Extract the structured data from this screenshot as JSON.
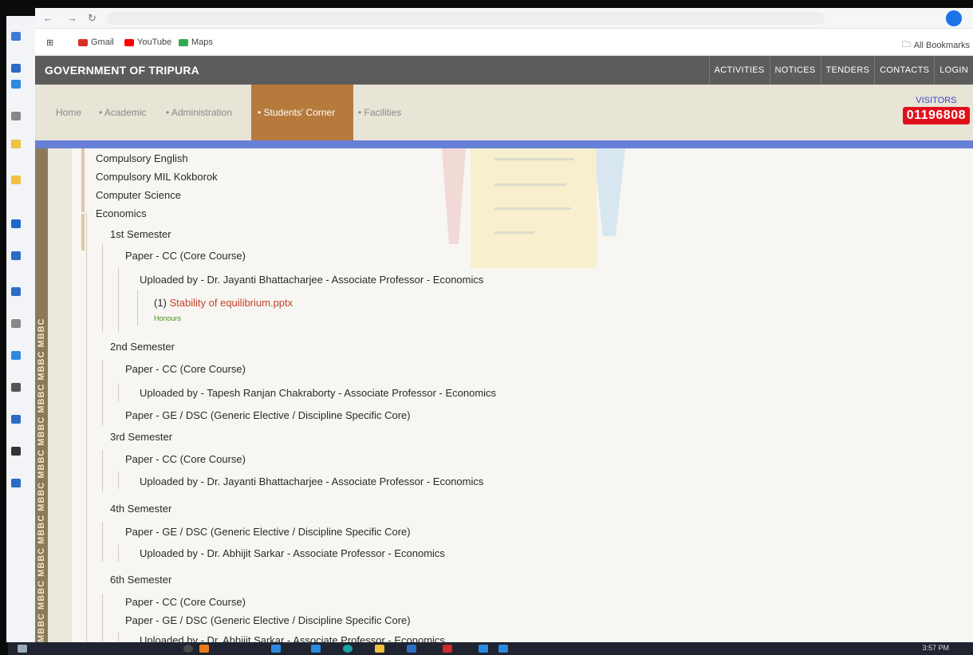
{
  "browser": {
    "bookmarks": [
      {
        "label": "Gmail",
        "color": "#d93025"
      },
      {
        "label": "YouTube",
        "color": "#ff0000"
      },
      {
        "label": "Maps",
        "color": "#34a853"
      }
    ],
    "all_bookmarks": "All Bookmarks"
  },
  "site": {
    "gov_title": "GOVERNMENT OF TRIPURA",
    "top_nav": [
      "ACTIVITIES",
      "NOTICES",
      "TENDERS",
      "CONTACTS",
      "LOGIN"
    ],
    "menu": [
      {
        "label": "Home",
        "active": false
      },
      {
        "label": "• Academic",
        "active": false
      },
      {
        "label": "• Administration",
        "active": false
      },
      {
        "label": "• Students' Corner",
        "active": true
      },
      {
        "label": "• Facilities",
        "active": false
      }
    ],
    "visitors_label": "VISITORS",
    "visitors_count": "01196808",
    "side_banner": "MBBC MBBC MBBC MBBC MBBC MBBC MBBC MBBC MBBC MBBC"
  },
  "tree": {
    "subjects": [
      "Compulsory English",
      "Compulsory MIL Kokborok",
      "Computer Science",
      "Economics"
    ],
    "sem1": {
      "title": "1st Semester",
      "paper": "Paper - CC (Core Course)",
      "uploader": "Uploaded by - Dr. Jayanti Bhattacharjee - Associate Professor - Economics",
      "file_index": "(1)",
      "file_name": "Stability of equilibrium.pptx",
      "file_tag": "Honours"
    },
    "sem2": {
      "title": "2nd Semester",
      "paper1": "Paper - CC (Core Course)",
      "uploader": "Uploaded by - Tapesh Ranjan Chakraborty - Associate Professor - Economics",
      "paper2": "Paper - GE / DSC (Generic Elective / Discipline Specific Core)"
    },
    "sem3": {
      "title": "3rd Semester",
      "paper": "Paper - CC (Core Course)",
      "uploader": "Uploaded by - Dr. Jayanti Bhattacharjee - Associate Professor - Economics"
    },
    "sem4": {
      "title": "4th Semester",
      "paper": "Paper - GE / DSC (Generic Elective / Discipline Specific Core)",
      "uploader": "Uploaded by - Dr. Abhijit Sarkar - Associate Professor - Economics"
    },
    "sem6": {
      "title": "6th Semester",
      "paper1": "Paper - CC (Core Course)",
      "paper2": "Paper - GE / DSC (Generic Elective / Discipline Specific Core)",
      "uploader": "Uploaded by - Dr. Abhijit Sarkar - Associate Professor - Economics"
    }
  },
  "taskbar": {
    "clock": "3:57 PM"
  }
}
